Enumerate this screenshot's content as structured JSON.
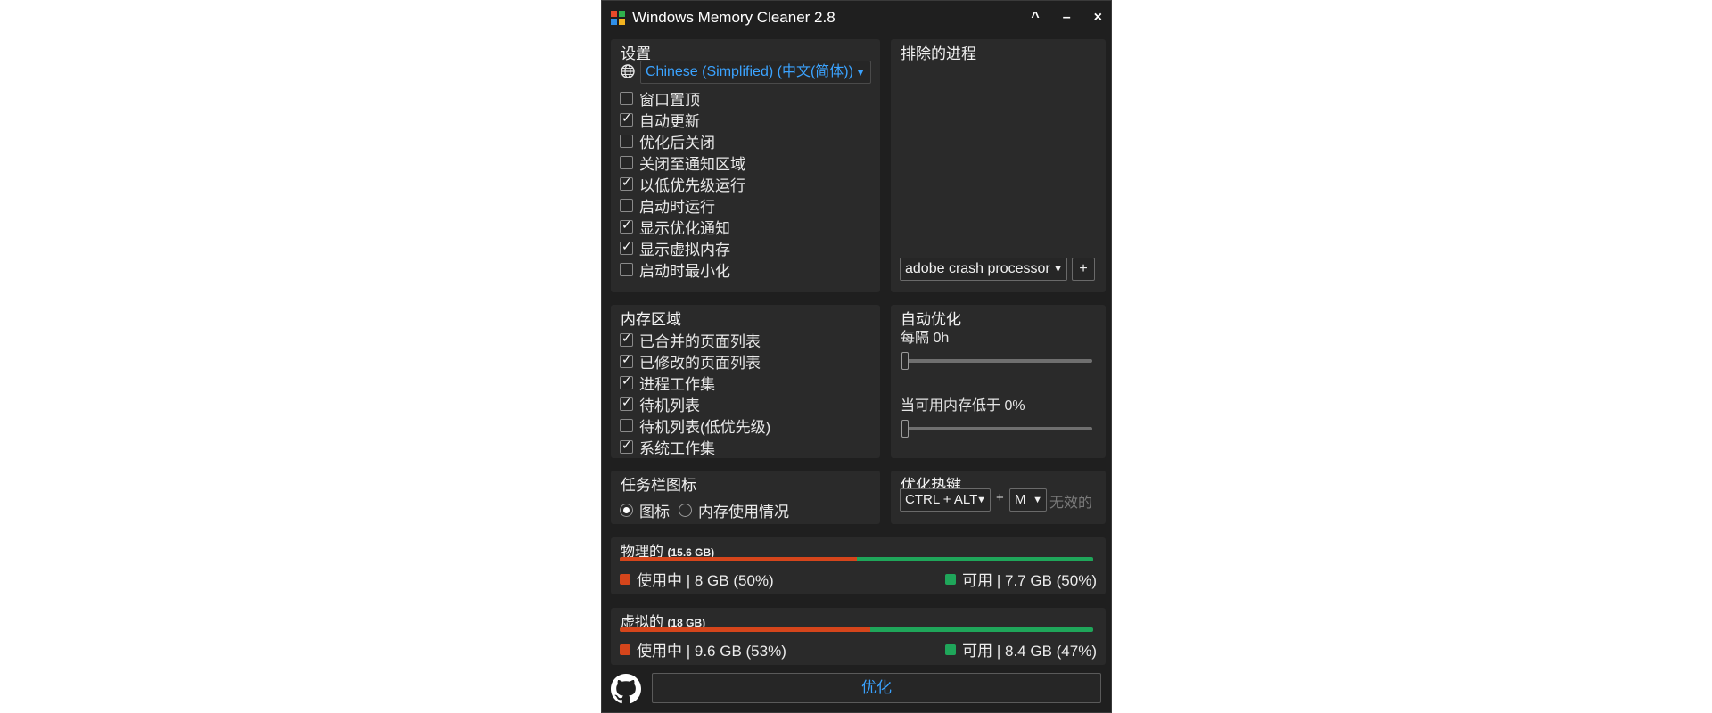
{
  "window": {
    "title": "Windows Memory Cleaner 2.8"
  },
  "titlebar_controls": {
    "collapse": "^",
    "minimize": "–",
    "close": "×"
  },
  "settings": {
    "title": "设置",
    "language": "Chinese (Simplified) (中文(简体))",
    "items": [
      {
        "label": "窗口置顶",
        "checked": false
      },
      {
        "label": "自动更新",
        "checked": true
      },
      {
        "label": "优化后关闭",
        "checked": false
      },
      {
        "label": "关闭至通知区域",
        "checked": false
      },
      {
        "label": "以低优先级运行",
        "checked": true
      },
      {
        "label": "启动时运行",
        "checked": false
      },
      {
        "label": "显示优化通知",
        "checked": true
      },
      {
        "label": "显示虚拟内存",
        "checked": true
      },
      {
        "label": "启动时最小化",
        "checked": false
      }
    ]
  },
  "excluded": {
    "title": "排除的进程",
    "process": "adobe crash processor",
    "add_label": "+"
  },
  "memory_areas": {
    "title": "内存区域",
    "items": [
      {
        "label": "已合并的页面列表",
        "checked": true
      },
      {
        "label": "已修改的页面列表",
        "checked": true
      },
      {
        "label": "进程工作集",
        "checked": true
      },
      {
        "label": "待机列表",
        "checked": true
      },
      {
        "label": "待机列表(低优先级)",
        "checked": false
      },
      {
        "label": "系统工作集",
        "checked": true
      }
    ]
  },
  "auto_optimize": {
    "title": "自动优化",
    "interval_label": "每隔 0h",
    "interval_value": 0,
    "threshold_label": "当可用内存低于 0%",
    "threshold_value": 0
  },
  "tray_icon": {
    "title": "任务栏图标",
    "options": [
      {
        "label": "图标",
        "selected": true
      },
      {
        "label": "内存使用情况",
        "selected": false
      }
    ]
  },
  "hotkey": {
    "title": "优化热键",
    "modifier": "CTRL + ALT",
    "plus": "+",
    "key": "M",
    "status": "无效的"
  },
  "physical": {
    "title": "物理的",
    "total": "(15.6 GB)",
    "used_label": "使用中 | 8 GB (50%)",
    "free_label": "可用 | 7.7 GB (50%)",
    "used_fraction": 0.5
  },
  "virtual": {
    "title": "虚拟的",
    "total": "(18 GB)",
    "used_label": "使用中 | 9.6 GB (53%)",
    "free_label": "可用 | 8.4 GB (47%)",
    "used_fraction": 0.53
  },
  "footer": {
    "optimize_label": "优化"
  },
  "colors": {
    "used": "#d5451b",
    "free": "#1fa65a",
    "accent": "#3ba3ff"
  }
}
